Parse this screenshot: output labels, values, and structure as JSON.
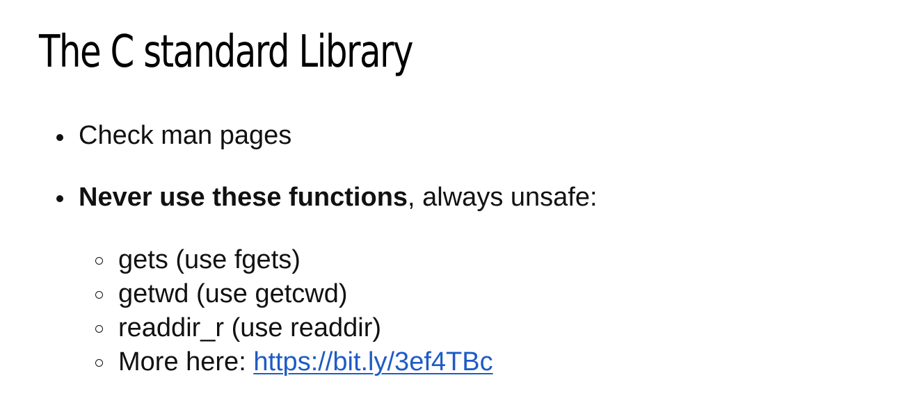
{
  "slide": {
    "title": "The C standard Library",
    "bullets": [
      {
        "text": "Check man pages"
      },
      {
        "bold": "Never use these functions",
        "rest": ", always unsafe:"
      }
    ],
    "subbullets": [
      {
        "text": "gets (use fgets)"
      },
      {
        "text": "getwd (use getcwd)"
      },
      {
        "text": "readdir_r (use readdir)"
      },
      {
        "prefix": "More here: ",
        "link": "https://bit.ly/3ef4TBc"
      }
    ]
  },
  "colors": {
    "text": "#111111",
    "link": "#1e5bc6",
    "background": "#ffffff"
  }
}
